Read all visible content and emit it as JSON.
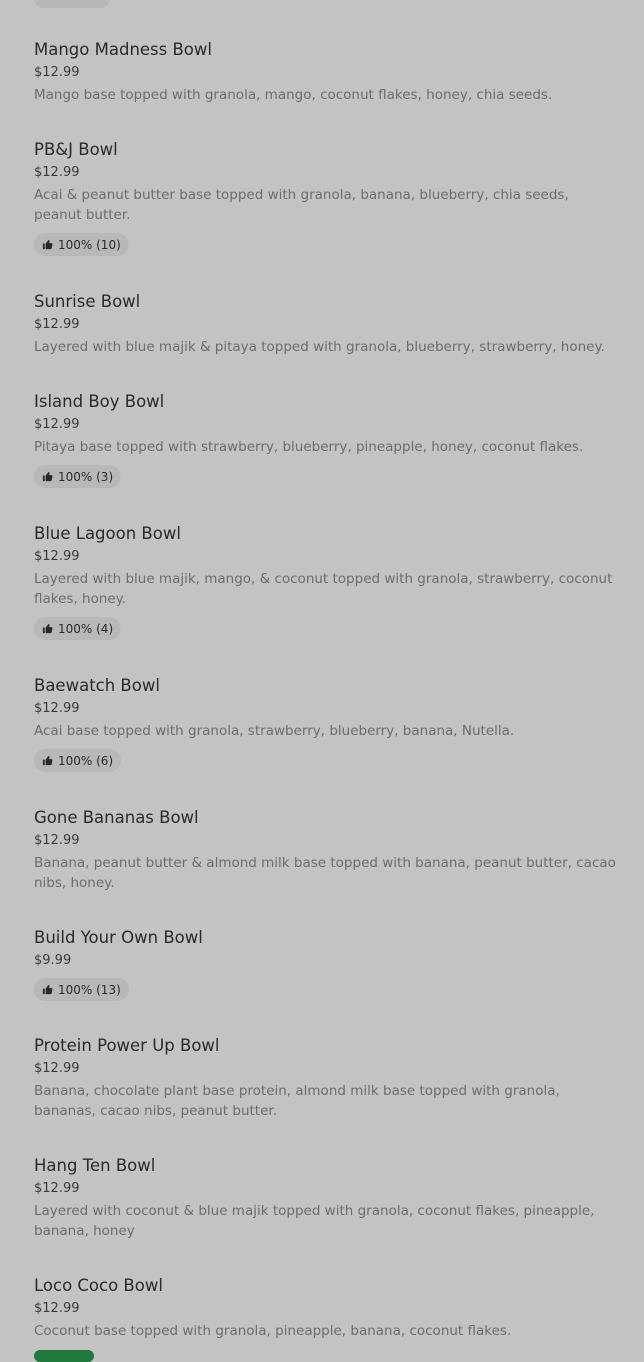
{
  "items": [
    {
      "name": "Mango Madness Bowl",
      "price": "$12.99",
      "description": "Mango base topped with granola, mango, coconut flakes, honey, chia seeds.",
      "rating": null
    },
    {
      "name": "PB&J Bowl",
      "price": "$12.99",
      "description": "Acai & peanut butter base topped with granola, banana, blueberry, chia seeds, peanut butter.",
      "rating": "100% (10)"
    },
    {
      "name": "Sunrise Bowl",
      "price": "$12.99",
      "description": "Layered with blue majik & pitaya topped with granola, blueberry, strawberry, honey.",
      "rating": null
    },
    {
      "name": "Island Boy Bowl",
      "price": "$12.99",
      "description": "Pitaya base topped with strawberry, blueberry, pineapple, honey, coconut flakes.",
      "rating": "100% (3)"
    },
    {
      "name": "Blue Lagoon Bowl",
      "price": "$12.99",
      "description": "Layered with blue majik, mango, & coconut topped with granola, strawberry, coconut flakes, honey.",
      "rating": "100% (4)"
    },
    {
      "name": "Baewatch Bowl",
      "price": "$12.99",
      "description": "Acai base topped with granola, strawberry, blueberry, banana, Nutella.",
      "rating": "100% (6)"
    },
    {
      "name": "Gone Bananas Bowl",
      "price": "$12.99",
      "description": "Banana, peanut butter & almond milk base topped with banana, peanut butter, cacao nibs, honey.",
      "rating": null
    },
    {
      "name": "Build Your Own Bowl",
      "price": "$9.99",
      "description": "",
      "rating": "100% (13)"
    },
    {
      "name": "Protein Power Up Bowl",
      "price": "$12.99",
      "description": "Banana, chocolate plant base protein, almond milk base topped with granola, bananas, cacao nibs, peanut butter.",
      "rating": null
    },
    {
      "name": "Hang Ten Bowl",
      "price": "$12.99",
      "description": "Layered with coconut & blue majik topped with granola, coconut flakes, pineapple, banana, honey",
      "rating": null
    },
    {
      "name": "Loco Coco Bowl",
      "price": "$12.99",
      "description": "Coconut base topped with granola, pineapple, banana, coconut flakes.",
      "rating": null
    }
  ],
  "icons": {
    "rating": "thumbs-up-icon"
  },
  "colors": {
    "background": "#c3c3c3",
    "badge": "#b8b8b8",
    "accent": "#1f7a3c"
  }
}
